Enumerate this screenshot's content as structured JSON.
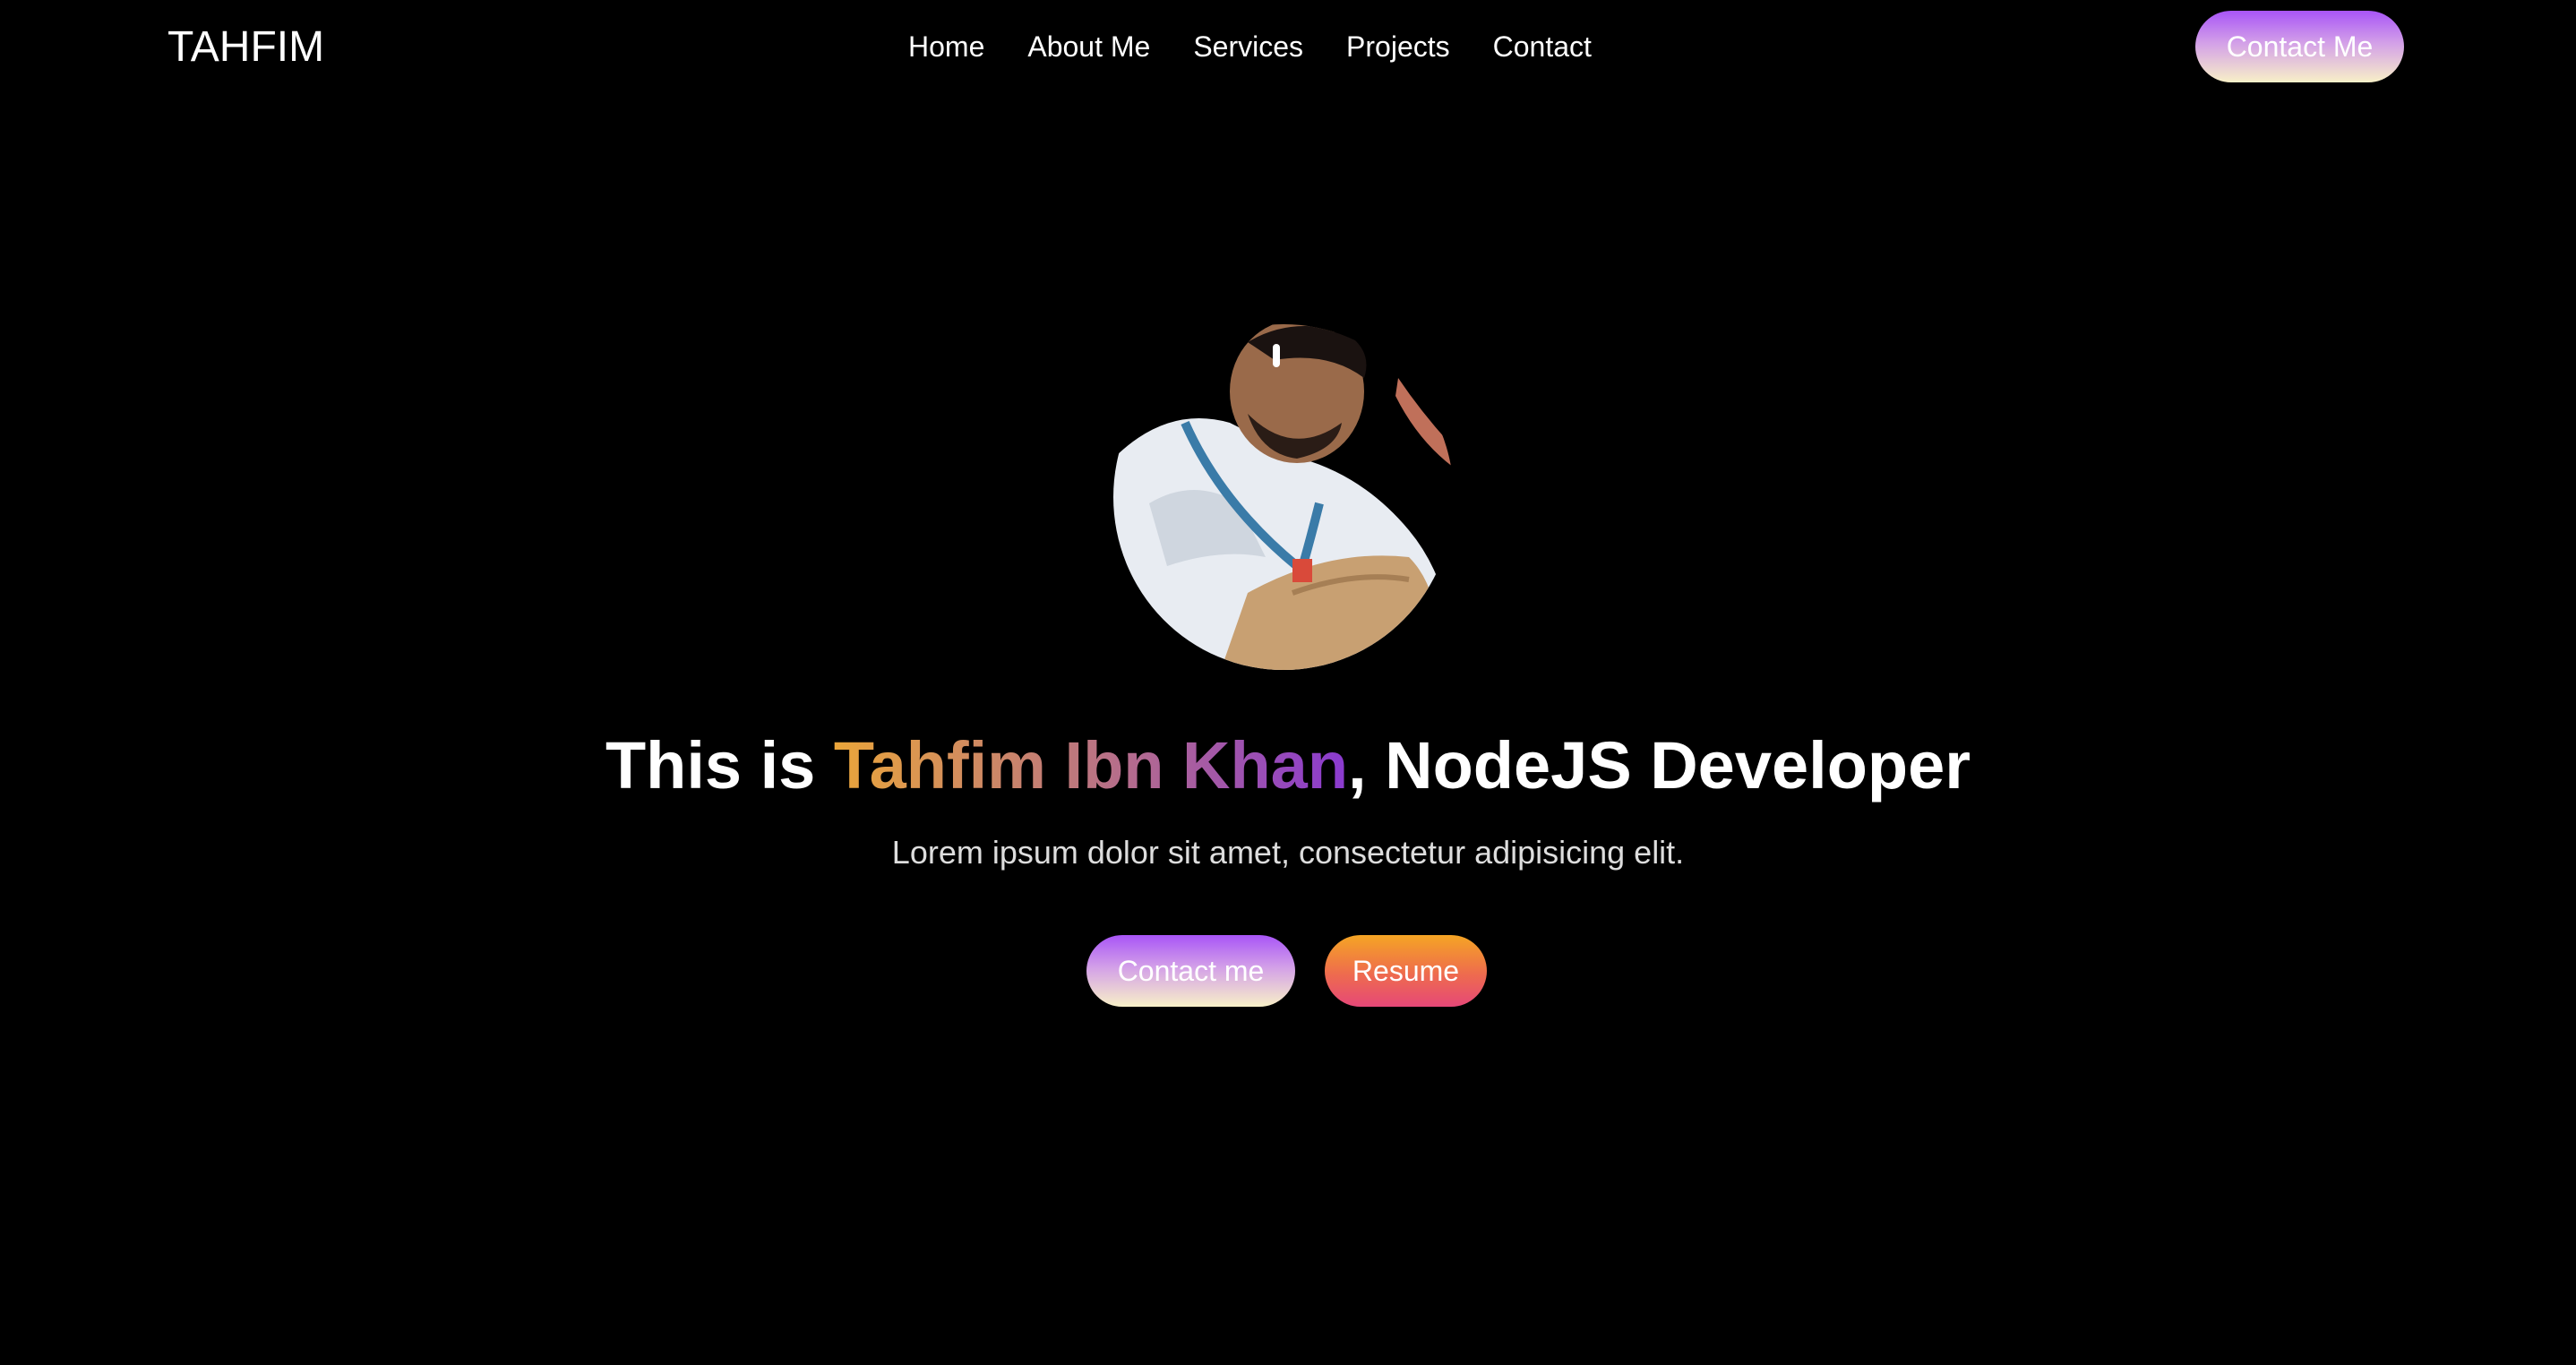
{
  "nav": {
    "logo": "TAHFIM",
    "links": [
      {
        "label": "Home"
      },
      {
        "label": "About Me"
      },
      {
        "label": "Services"
      },
      {
        "label": "Projects"
      },
      {
        "label": "Contact"
      }
    ],
    "cta_label": "Contact Me"
  },
  "hero": {
    "headline_prefix": "This is ",
    "headline_name": "Tahfim Ibn Khan",
    "headline_suffix": ", NodeJS Developer",
    "subtitle": "Lorem ipsum dolor sit amet, consectetur adipisicing elit.",
    "primary_button": "Contact me",
    "secondary_button": "Resume"
  },
  "colors": {
    "background": "#000000",
    "text": "#ffffff",
    "purple_gradient": [
      "#a855f7",
      "#f8f0c8"
    ],
    "orange_gradient": [
      "#f5a524",
      "#e64878"
    ],
    "name_gradient": [
      "#eaa53a",
      "#8a3ad0"
    ]
  }
}
